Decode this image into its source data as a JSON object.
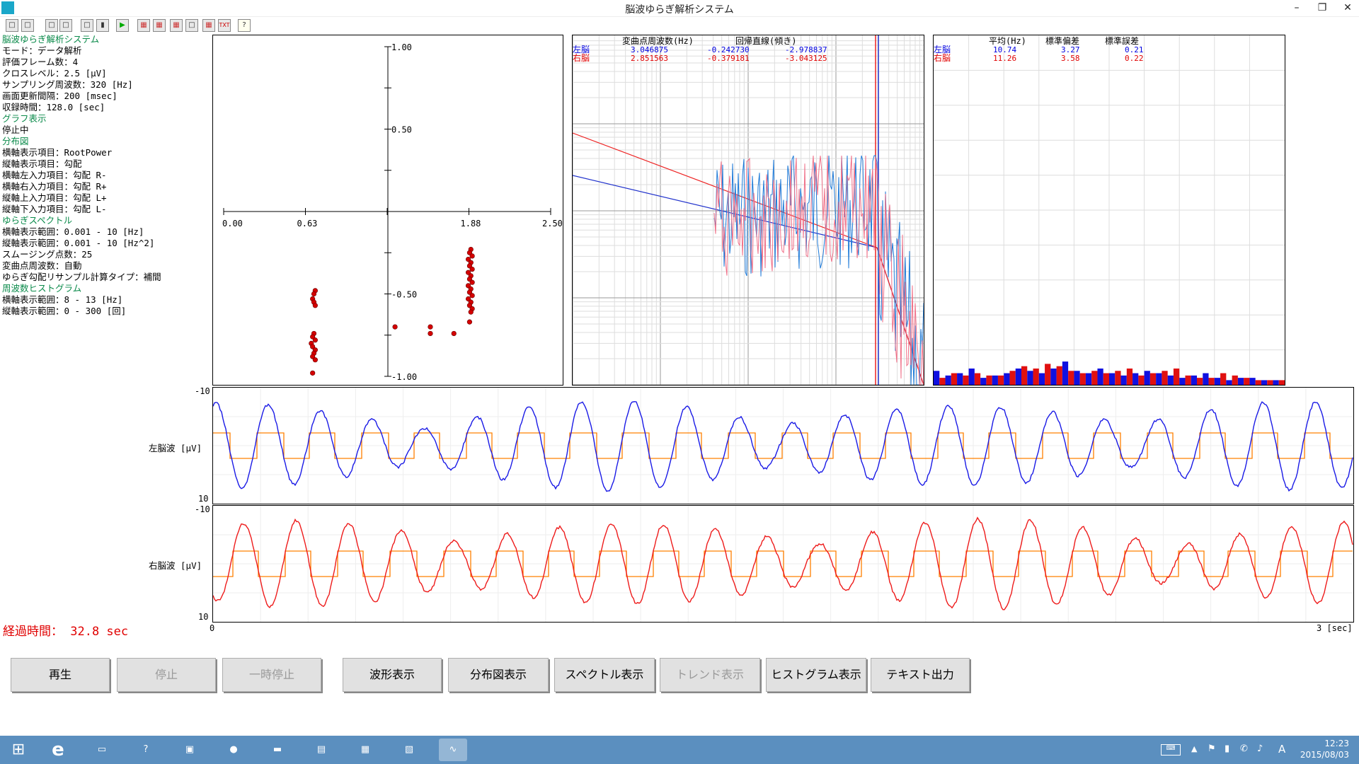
{
  "window": {
    "title": "脳波ゆらぎ解析システム",
    "minimize": "–",
    "restore": "❐",
    "close": "✕"
  },
  "toolbar": {
    "icons": [
      "info-icon",
      "grid-icon",
      "stop-rec-icon",
      "tag-icon",
      "square-icon",
      "pause-icon",
      "play-icon",
      "wave-icon",
      "scatter-icon",
      "spectrum-icon",
      "trend-icon",
      "histogram-icon",
      "txt-icon",
      "help-icon"
    ],
    "txt_label": "TXT",
    "help_label": "?"
  },
  "info": [
    {
      "t": "脳波ゆらぎ解析システム",
      "h": true
    },
    {
      "t": " モード：データ解析"
    },
    {
      "t": " 評価フレーム数：4"
    },
    {
      "t": " クロスレベル：2.5 [μV]"
    },
    {
      "t": " サンプリング周波数：320 [Hz]"
    },
    {
      "t": " 画面更新間隔：200 [msec]"
    },
    {
      "t": " 収録時間：128.0 [sec]"
    },
    {
      "t": "グラフ表示",
      "h": true
    },
    {
      "t": " 停止中"
    },
    {
      "t": "分布図",
      "h": true
    },
    {
      "t": " 横軸表示項目：RootPower"
    },
    {
      "t": " 縦軸表示項目：勾配"
    },
    {
      "t": " 横軸左入力項目：勾配 R-"
    },
    {
      "t": " 横軸右入力項目：勾配 R+"
    },
    {
      "t": " 縦軸上入力項目：勾配 L+"
    },
    {
      "t": " 縦軸下入力項目：勾配 L-"
    },
    {
      "t": "ゆらぎスペクトル",
      "h": true
    },
    {
      "t": " 横軸表示範囲：0.001 - 10 [Hz]"
    },
    {
      "t": " 縦軸表示範囲：0.001 - 10 [Hz^2]"
    },
    {
      "t": " スムージング点数：25"
    },
    {
      "t": " 変曲点周波数：自動"
    },
    {
      "t": " ゆらぎ勾配リサンプル計算タイプ：補間"
    },
    {
      "t": "周波数ヒストグラム",
      "h": true
    },
    {
      "t": " 横軸表示範囲：8 - 13 [Hz]"
    },
    {
      "t": " 縦軸表示範囲：0 - 300 [回]"
    }
  ],
  "scatter": {
    "x_ticks": [
      "0.00",
      "0.63",
      "1.88",
      "2.50"
    ],
    "y_ticks": [
      "1.00",
      "0.50",
      "-0.50",
      "-1.00"
    ],
    "color": "#d40000",
    "points": [
      [
        0.7,
        -0.48
      ],
      [
        0.69,
        -0.5
      ],
      [
        0.68,
        -0.53
      ],
      [
        0.69,
        -0.55
      ],
      [
        0.7,
        -0.57
      ],
      [
        0.69,
        -0.74
      ],
      [
        0.68,
        -0.76
      ],
      [
        0.7,
        -0.78
      ],
      [
        0.67,
        -0.8
      ],
      [
        0.68,
        -0.82
      ],
      [
        0.7,
        -0.84
      ],
      [
        0.69,
        -0.86
      ],
      [
        0.68,
        -0.88
      ],
      [
        0.7,
        -0.9
      ],
      [
        0.68,
        -0.98
      ],
      [
        1.31,
        -0.7
      ],
      [
        1.58,
        -0.7
      ],
      [
        1.58,
        -0.74
      ],
      [
        1.76,
        -0.74
      ],
      [
        1.89,
        -0.23
      ],
      [
        1.88,
        -0.25
      ],
      [
        1.9,
        -0.27
      ],
      [
        1.87,
        -0.29
      ],
      [
        1.89,
        -0.31
      ],
      [
        1.88,
        -0.33
      ],
      [
        1.9,
        -0.35
      ],
      [
        1.87,
        -0.37
      ],
      [
        1.89,
        -0.39
      ],
      [
        1.88,
        -0.41
      ],
      [
        1.9,
        -0.43
      ],
      [
        1.87,
        -0.45
      ],
      [
        1.89,
        -0.47
      ],
      [
        1.88,
        -0.49
      ],
      [
        1.9,
        -0.51
      ],
      [
        1.87,
        -0.53
      ],
      [
        1.89,
        -0.55
      ],
      [
        1.88,
        -0.57
      ],
      [
        1.9,
        -0.59
      ],
      [
        1.89,
        -0.61
      ],
      [
        1.88,
        -0.67
      ]
    ]
  },
  "spectrum": {
    "headers": [
      "変曲点周波数(Hz)",
      "回帰直線(傾き)"
    ],
    "rows": [
      {
        "label": "左脳",
        "freq": "3.046875",
        "slope1": "-0.242730",
        "slope2": "-2.978837",
        "color": "#0000e0"
      },
      {
        "label": "右脳",
        "freq": "2.851563",
        "slope1": "-0.379181",
        "slope2": "-3.043125",
        "color": "#e00000"
      }
    ]
  },
  "histogram": {
    "headers": [
      "平均(Hz)",
      "標準偏差",
      "標準誤差"
    ],
    "rows": [
      {
        "label": "左脳",
        "mean": "10.74",
        "sd": "3.27",
        "se": "0.21",
        "color": "#0000e0"
      },
      {
        "label": "右脳",
        "mean": "11.26",
        "sd": "3.58",
        "se": "0.22",
        "color": "#e00000"
      }
    ],
    "bars_left": [
      12,
      8,
      10,
      14,
      6,
      8,
      10,
      14,
      12,
      10,
      14,
      20,
      12,
      10,
      14,
      10,
      8,
      10,
      12,
      10,
      8,
      6,
      8,
      10,
      6,
      4,
      6,
      6,
      4,
      4
    ],
    "bars_right": [
      6,
      10,
      8,
      10,
      8,
      8,
      12,
      16,
      14,
      18,
      16,
      12,
      10,
      12,
      10,
      12,
      14,
      8,
      10,
      12,
      14,
      8,
      6,
      6,
      10,
      8,
      6,
      4,
      4,
      4
    ]
  },
  "waves": {
    "left": {
      "label": "左脳波 [μV]",
      "top": "-10",
      "bottom": "10",
      "color": "#1a1ae6"
    },
    "right": {
      "label": "右脳波 [μV]",
      "top": "-10",
      "bottom": "10",
      "color": "#ee1b1b"
    },
    "x_start": "0",
    "x_end": "3 [sec]",
    "cross_color": "#ff8000"
  },
  "elapsed": "経過時間： 32.8 sec",
  "buttons": [
    {
      "label": "再生",
      "enabled": true
    },
    {
      "label": "停止",
      "enabled": false
    },
    {
      "label": "一時停止",
      "enabled": false
    },
    {
      "label": "波形表示",
      "enabled": true
    },
    {
      "label": "分布図表示",
      "enabled": true
    },
    {
      "label": "スペクトル表示",
      "enabled": true
    },
    {
      "label": "トレンド表示",
      "enabled": false
    },
    {
      "label": "ヒストグラム表示",
      "enabled": true
    },
    {
      "label": "テキスト出力",
      "enabled": true
    }
  ],
  "taskbar": {
    "items": [
      "windows-start-icon",
      "ie-icon",
      "file-explorer-icon",
      "help-book-icon",
      "remote-desktop-icon",
      "firefox-icon",
      "cmd-icon",
      "monitor-icon",
      "calculator-icon",
      "network-icon",
      "eeg-app-icon"
    ],
    "time": "12:23",
    "date": "2015/08/03",
    "ime": "A"
  }
}
